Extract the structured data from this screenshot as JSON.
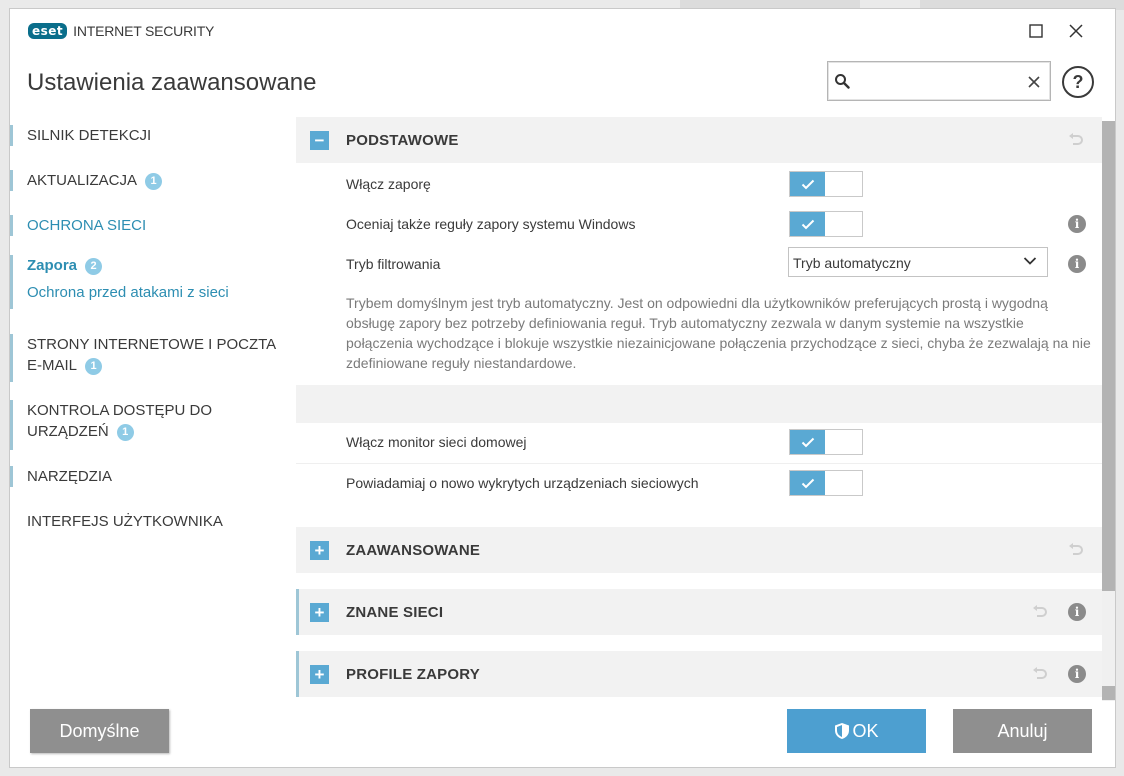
{
  "window": {
    "brand_mark": "eset",
    "product_name": "INTERNET SECURITY",
    "page_title": "Ustawienia zaawansowane"
  },
  "search": {
    "value": "",
    "placeholder": ""
  },
  "help_label": "?",
  "sidebar": {
    "items": [
      {
        "label": "SILNIK DETEKCJI",
        "badge": ""
      },
      {
        "label": "AKTUALIZACJA",
        "badge": "1"
      },
      {
        "label": "OCHRONA SIECI",
        "badge": ""
      },
      {
        "label": "Zapora",
        "badge": "2"
      },
      {
        "label": "Ochrona przed atakami z sieci",
        "badge": ""
      },
      {
        "label_line1": "STRONY INTERNETOWE I POCZTA",
        "label_line2": "E-MAIL",
        "badge": "1"
      },
      {
        "label_line1": "KONTROLA DOSTĘPU DO",
        "label_line2": "URZĄDZEŃ",
        "badge": "1"
      },
      {
        "label": "NARZĘDZIA",
        "badge": ""
      },
      {
        "label": "INTERFEJS UŻYTKOWNIKA",
        "badge": ""
      }
    ]
  },
  "sections": {
    "basic": {
      "label": "PODSTAWOWE",
      "expanded": true,
      "rows": [
        {
          "label": "Włącz zaporę",
          "enabled": true
        },
        {
          "label": "Oceniaj także reguły zapory systemu Windows",
          "enabled": true
        },
        {
          "label": "Tryb filtrowania",
          "selected": "Tryb automatyczny"
        }
      ],
      "description": "Trybem domyślnym jest tryb automatyczny. Jest on odpowiedni dla użytkowników preferujących prostą i wygodną obsługę zapory bez potrzeby definiowania reguł. Tryb automatyczny zezwala w danym systemie na wszystkie połączenia wychodzące i blokuje wszystkie niezainicjowane połączenia przychodzące z sieci, chyba że zezwalają na nie zdefiniowane reguły niestandardowe.",
      "rows2": [
        {
          "label": "Włącz monitor sieci domowej",
          "enabled": true
        },
        {
          "label": "Powiadamiaj o nowo wykrytych urządzeniach sieciowych",
          "enabled": true
        }
      ]
    },
    "advanced": {
      "label": "ZAAWANSOWANE",
      "expanded": false
    },
    "known_networks": {
      "label": "ZNANE SIECI",
      "expanded": false
    },
    "profiles": {
      "label": "PROFILE ZAPORY",
      "expanded": false
    }
  },
  "footer": {
    "default_label": "Domyślne",
    "ok_label": "OK",
    "cancel_label": "Anuluj"
  },
  "colors": {
    "accent": "#5aa9d3",
    "link": "#2d8eb2",
    "badge": "#8fcbe6",
    "gray_button": "#8f8f8f",
    "ok_button": "#4d9fd0"
  },
  "icons": {
    "search": "search-icon",
    "clear": "close-icon",
    "revert": "revert-icon",
    "info": "info-icon",
    "check": "check-icon",
    "chevron": "chevron-down-icon",
    "shield": "shield-icon"
  }
}
